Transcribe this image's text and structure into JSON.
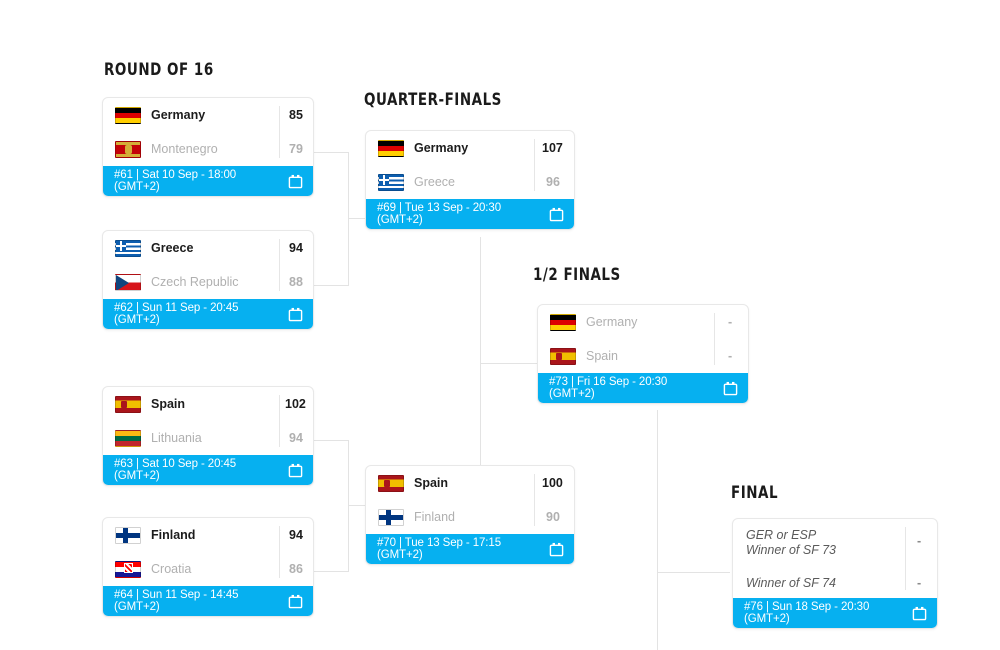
{
  "bracket": {
    "rounds": [
      {
        "key": "r16",
        "label": "ROUND OF 16"
      },
      {
        "key": "qf",
        "label": "QUARTER-FINALS"
      },
      {
        "key": "sf",
        "label": "1/2 FINALS"
      },
      {
        "key": "final",
        "label": "FINAL"
      }
    ],
    "accent_color": "#06b0f0",
    "line_color": "#e3e3e3",
    "calendar_icon": "calendar-icon"
  },
  "matches": {
    "m61": {
      "id": "#61",
      "home": {
        "team": "Germany",
        "flag": "f-de",
        "score": "85",
        "winner": true
      },
      "away": {
        "team": "Montenegro",
        "flag": "f-me",
        "score": "79",
        "winner": false
      },
      "date_line1": "#61 | Sat 10 Sep - 18:00",
      "date_line2": "(GMT+2)"
    },
    "m62": {
      "id": "#62",
      "home": {
        "team": "Greece",
        "flag": "f-gr",
        "score": "94",
        "winner": true
      },
      "away": {
        "team": "Czech Republic",
        "flag": "f-cz",
        "score": "88",
        "winner": false
      },
      "date_line1": "#62 | Sun 11 Sep - 20:45",
      "date_line2": "(GMT+2)"
    },
    "m63": {
      "id": "#63",
      "home": {
        "team": "Spain",
        "flag": "f-es",
        "score": "102",
        "winner": true
      },
      "away": {
        "team": "Lithuania",
        "flag": "f-lt",
        "score": "94",
        "winner": false
      },
      "date_line1": "#63 | Sat 10 Sep - 20:45",
      "date_line2": "(GMT+2)"
    },
    "m64": {
      "id": "#64",
      "home": {
        "team": "Finland",
        "flag": "f-fi",
        "score": "94",
        "winner": true
      },
      "away": {
        "team": "Croatia",
        "flag": "f-hr",
        "score": "86",
        "winner": false
      },
      "date_line1": "#64 | Sun 11 Sep - 14:45",
      "date_line2": "(GMT+2)"
    },
    "m69": {
      "id": "#69",
      "home": {
        "team": "Germany",
        "flag": "f-de",
        "score": "107",
        "winner": true
      },
      "away": {
        "team": "Greece",
        "flag": "f-gr",
        "score": "96",
        "winner": false
      },
      "date_line1": "#69 | Tue 13 Sep - 20:30",
      "date_line2": "(GMT+2)"
    },
    "m70": {
      "id": "#70",
      "home": {
        "team": "Spain",
        "flag": "f-es",
        "score": "100",
        "winner": true
      },
      "away": {
        "team": "Finland",
        "flag": "f-fi",
        "score": "90",
        "winner": false
      },
      "date_line1": "#70 | Tue 13 Sep - 17:15",
      "date_line2": "(GMT+2)"
    },
    "m73": {
      "id": "#73",
      "home": {
        "team": "Germany",
        "flag": "f-de",
        "score": "-",
        "winner": false
      },
      "away": {
        "team": "Spain",
        "flag": "f-es",
        "score": "-",
        "winner": false
      },
      "date_line1": "#73 | Fri 16 Sep - 20:30",
      "date_line2": "(GMT+2)"
    },
    "m76": {
      "id": "#76",
      "home": {
        "team": "GER or ESP",
        "team_sub": "Winner of SF 73",
        "score": "-"
      },
      "away": {
        "team": "Winner of SF 74",
        "team_sub": "",
        "score": "-"
      },
      "date_line1": "#76 | Sun 18 Sep - 20:30",
      "date_line2": "(GMT+2)"
    }
  }
}
